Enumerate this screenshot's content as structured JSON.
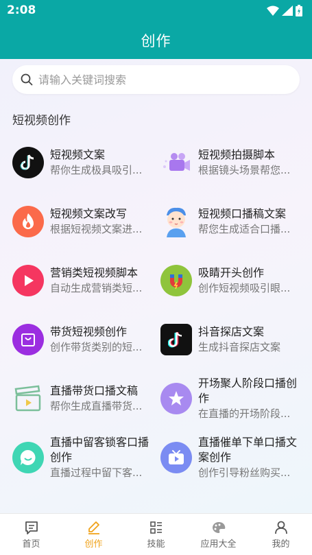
{
  "status": {
    "time": "2:08"
  },
  "header": {
    "title": "创作"
  },
  "search": {
    "placeholder": "请输入关键词搜索"
  },
  "section": {
    "title": "短视频创作"
  },
  "cards": [
    {
      "title": "短视频文案",
      "desc": "帮你生成极具吸引...",
      "icon": "tiktok-icon"
    },
    {
      "title": "短视频拍摄脚本",
      "desc": "根据镜头场景帮您...",
      "icon": "video-camera-icon"
    },
    {
      "title": "短视频文案改写",
      "desc": "根据短视频文案进...",
      "icon": "flame-icon"
    },
    {
      "title": "短视频口播稿文案",
      "desc": "帮您生成适合口播...",
      "icon": "cartoon-face-icon"
    },
    {
      "title": "营销类短视频脚本",
      "desc": "自动生成营销类短...",
      "icon": "play-icon"
    },
    {
      "title": "吸睛开头创作",
      "desc": "创作短视频吸引眼...",
      "icon": "magnet-icon"
    },
    {
      "title": "带货短视频创作",
      "desc": "创作带货类别的短...",
      "icon": "shopping-bag-icon"
    },
    {
      "title": "抖音探店文案",
      "desc": "生成抖音探店文案",
      "icon": "tiktok-app-icon"
    },
    {
      "title": "直播带货口播文稿",
      "desc": "帮你生成直播带货...",
      "icon": "clapperboard-icon"
    },
    {
      "title": "开场聚人阶段口播创作",
      "desc": "在直播的开场阶段...",
      "icon": "star-icon"
    },
    {
      "title": "直播中留客锁客口播创作",
      "desc": "直播过程中留下客...",
      "icon": "chat-bubble-icon"
    },
    {
      "title": "直播催单下单口播文案创作",
      "desc": "创作引导粉丝购买...",
      "icon": "tv-play-icon"
    }
  ],
  "tabs": [
    {
      "label": "首页",
      "icon": "message-icon",
      "active": false
    },
    {
      "label": "创作",
      "icon": "pencil-icon",
      "active": true
    },
    {
      "label": "技能",
      "icon": "grid-list-icon",
      "active": false
    },
    {
      "label": "应用大全",
      "icon": "palette-icon",
      "active": false
    },
    {
      "label": "我的",
      "icon": "user-icon",
      "active": false
    }
  ],
  "colors": {
    "header": "#0aa8a5",
    "active_tab": "#f0a21a"
  }
}
